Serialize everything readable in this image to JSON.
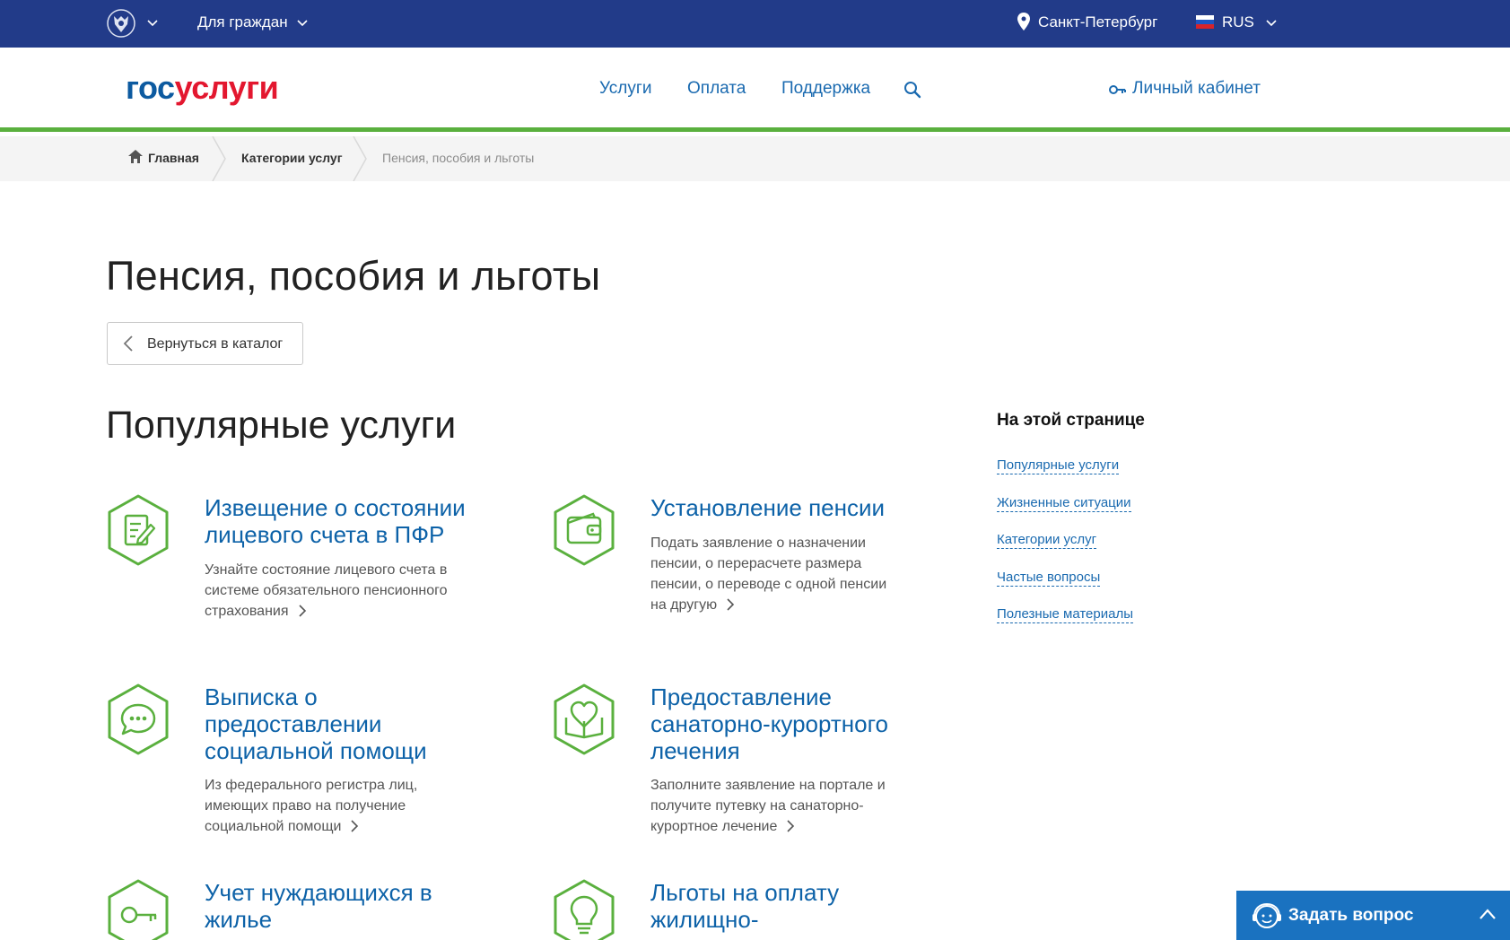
{
  "topbar": {
    "audience": "Для граждан",
    "city": "Санкт-Петербург",
    "language": "RUS"
  },
  "header": {
    "logo_part1": "гос",
    "logo_part2": "услуги",
    "nav": [
      "Услуги",
      "Оплата",
      "Поддержка"
    ],
    "cabinet": "Личный кабинет"
  },
  "breadcrumb": {
    "home": "Главная",
    "categories": "Категории услуг",
    "current": "Пенсия, пособия и льготы"
  },
  "page": {
    "title": "Пенсия, пособия и льготы",
    "back": "Вернуться в каталог",
    "section_title": "Популярные услуги"
  },
  "services": [
    {
      "icon": "document-edit-icon",
      "title": "Извещение о состоянии лицевого счета в ПФР",
      "desc": "Узнайте состояние лицевого счета в системе обязательного пенсионного страхования"
    },
    {
      "icon": "wallet-icon",
      "title": "Установление пенсии",
      "desc": "Подать заявление о назначении пенсии, о перерасчете размера пенсии, о переводе с одной пенсии на другую"
    },
    {
      "icon": "chat-bubble-icon",
      "title": "Выписка о предоставлении социальной помощи",
      "desc": "Из федерального регистра лиц, имеющих право на получение социальной помощи"
    },
    {
      "icon": "heart-book-icon",
      "title": "Предоставление санаторно-курортного лечения",
      "desc": "Заполните заявление на портале и получите путевку на санаторно-курортное лечение"
    },
    {
      "icon": "key-icon",
      "title": "Учет нуждающихся в жилье",
      "desc": ""
    },
    {
      "icon": "lightbulb-icon",
      "title": "Льготы на оплату жилищно-",
      "desc": ""
    }
  ],
  "on_page": {
    "title": "На этой странице",
    "links": [
      "Популярные услуги",
      "Жизненные ситуации",
      "Категории услуг",
      "Частые вопросы",
      "Полезные материалы"
    ]
  },
  "ask": {
    "label": "Задать вопрос"
  },
  "colors": {
    "topbar": "#223b89",
    "accent_green": "#5ab03e",
    "link_blue": "#1a6ab0",
    "logo_red": "#e3172f"
  }
}
